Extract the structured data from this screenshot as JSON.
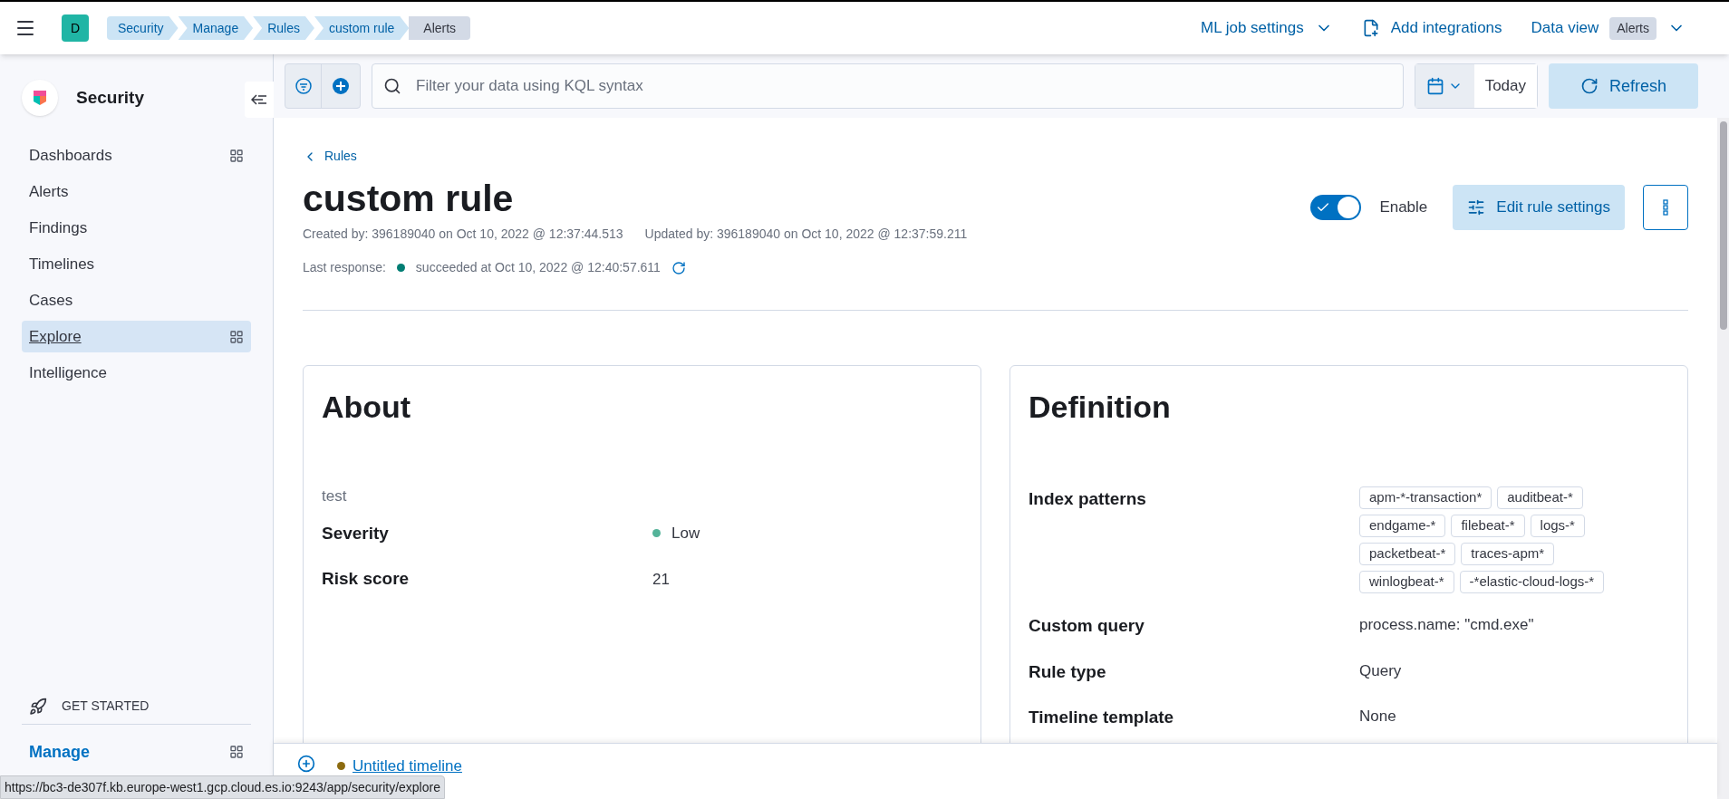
{
  "header": {
    "space_avatar": "D",
    "breadcrumbs": [
      {
        "label": "Security",
        "selected": false
      },
      {
        "label": "Manage",
        "selected": false
      },
      {
        "label": "Rules",
        "selected": false
      },
      {
        "label": "custom rule",
        "selected": false
      },
      {
        "label": "Alerts",
        "selected": true
      }
    ],
    "ml_job_settings": "ML job settings",
    "add_integrations": "Add integrations",
    "data_view": {
      "label": "Data view",
      "badge": "Alerts"
    }
  },
  "sidebar": {
    "title": "Security",
    "items": [
      {
        "label": "Dashboards",
        "grid": true,
        "selected": false
      },
      {
        "label": "Alerts",
        "grid": false,
        "selected": false
      },
      {
        "label": "Findings",
        "grid": false,
        "selected": false
      },
      {
        "label": "Timelines",
        "grid": false,
        "selected": false
      },
      {
        "label": "Cases",
        "grid": false,
        "selected": false
      },
      {
        "label": "Explore",
        "grid": true,
        "selected": true
      },
      {
        "label": "Intelligence",
        "grid": false,
        "selected": false
      }
    ],
    "get_started": "GET STARTED",
    "manage": "Manage"
  },
  "query_bar": {
    "placeholder": "Filter your data using KQL syntax",
    "date": "Today",
    "refresh": "Refresh"
  },
  "rule": {
    "back": "Rules",
    "title": "custom rule",
    "created": "Created by: 396189040 on Oct 10, 2022 @ 12:37:44.513",
    "updated": "Updated by: 396189040 on Oct 10, 2022 @ 12:37:59.211",
    "last_response_label": "Last response:",
    "last_response": "succeeded at Oct 10, 2022 @ 12:40:57.611",
    "enabled": true,
    "enable_label": "Enable",
    "edit": "Edit rule settings"
  },
  "about": {
    "title": "About",
    "description": "test",
    "rows": [
      {
        "label": "Severity",
        "value": "Low",
        "color": "#54b399"
      },
      {
        "label": "Risk score",
        "value": "21"
      }
    ]
  },
  "definition": {
    "title": "Definition",
    "index_label": "Index patterns",
    "index_patterns": [
      "apm-*-transaction*",
      "auditbeat-*",
      "endgame-*",
      "filebeat-*",
      "logs-*",
      "packetbeat-*",
      "traces-apm*",
      "winlogbeat-*",
      "-*elastic-cloud-logs-*"
    ],
    "rows": [
      {
        "label": "Custom query",
        "value": "process.name: \"cmd.exe\""
      },
      {
        "label": "Rule type",
        "value": "Query"
      },
      {
        "label": "Timeline template",
        "value": "None"
      }
    ]
  },
  "timeline": {
    "title": "Untitled timeline"
  },
  "status_url": "https://bc3-de307f.kb.europe-west1.gcp.cloud.es.io:9243/app/security/explore"
}
